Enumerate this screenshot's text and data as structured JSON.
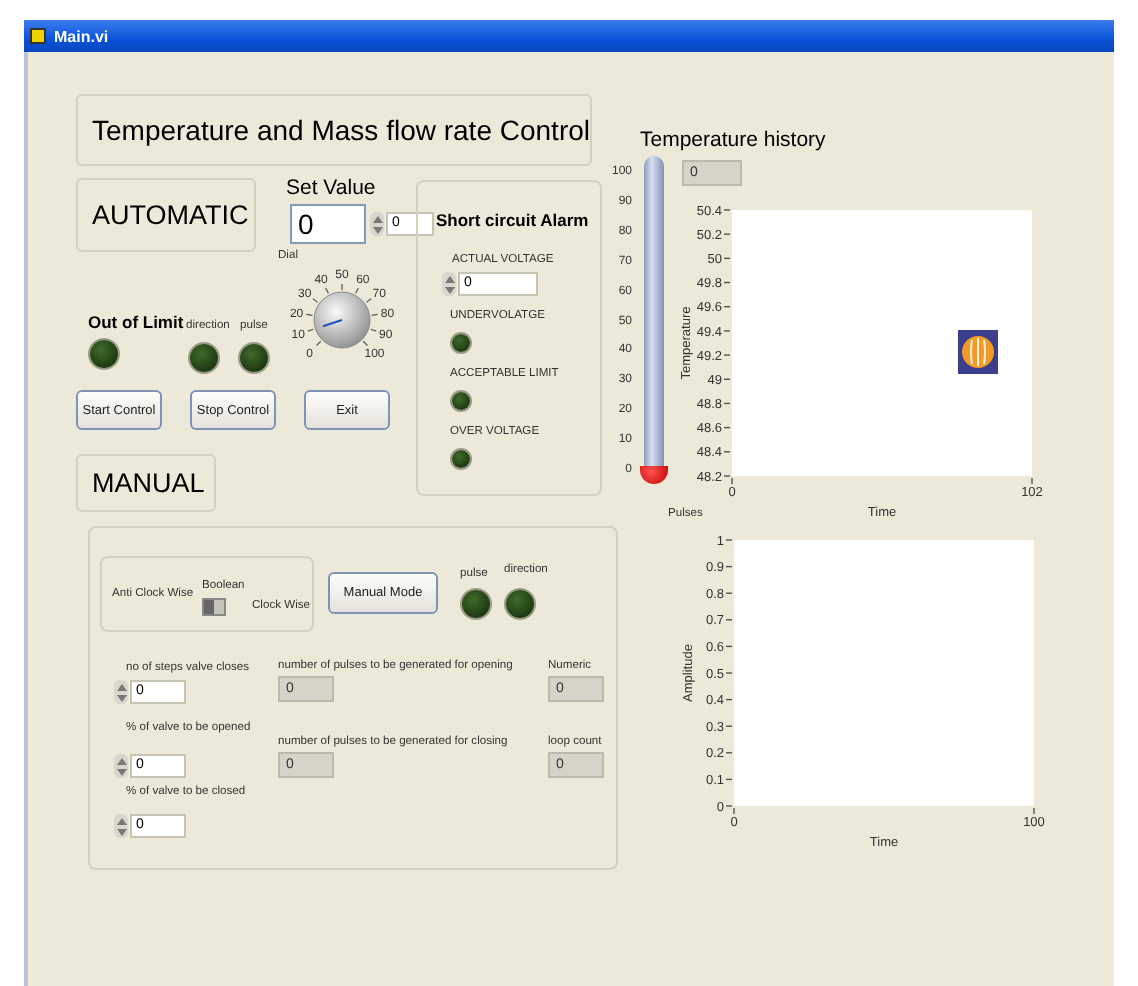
{
  "window": {
    "title": "Main.vi"
  },
  "heading": "Temperature and Mass flow rate Control",
  "automatic": {
    "label": "AUTOMATIC",
    "out_of_limit": {
      "label": "Out of Limit",
      "on": false
    },
    "leds": [
      {
        "label": "direction",
        "on": false
      },
      {
        "label": "pulse",
        "on": false
      }
    ],
    "set_value": {
      "label": "Set Value",
      "value": "0",
      "spinner_value": "0"
    },
    "dial": {
      "label": "Dial",
      "ticks": [
        "0",
        "10",
        "20",
        "30",
        "40",
        "50",
        "60",
        "70",
        "80",
        "90",
        "100"
      ]
    },
    "buttons": [
      "Start Control",
      "Stop Control",
      "Exit"
    ]
  },
  "alarm": {
    "title": "Short circuit  Alarm",
    "actual_voltage": {
      "label": "ACTUAL VOLTAGE",
      "value": "0"
    },
    "indicators": [
      {
        "label": "UNDERVOLATGE",
        "on": false
      },
      {
        "label": "ACCEPTABLE LIMIT",
        "on": false
      },
      {
        "label": "OVER VOLTAGE",
        "on": false
      }
    ]
  },
  "manual": {
    "label": "MANUAL",
    "switch": {
      "left_label": "Anti Clock Wise",
      "label": "Boolean",
      "right_label": "Clock Wise",
      "on": false
    },
    "mode_button": "Manual Mode",
    "leds": [
      {
        "label": "pulse",
        "on": false
      },
      {
        "label": "direction",
        "on": false
      }
    ],
    "inputs": [
      {
        "label": "no of steps valve closes",
        "value": "0"
      },
      {
        "label": "% of valve to be opened",
        "value": "0"
      },
      {
        "label": "% of valve to be  closed",
        "value": "0"
      }
    ],
    "outputs": [
      {
        "label": "number of pulses to be generated for opening",
        "value": "0"
      },
      {
        "label": "Numeric",
        "value": "0"
      },
      {
        "label": "number of pulses to be generated for closing",
        "value": "0"
      },
      {
        "label": "loop count",
        "value": "0"
      }
    ]
  },
  "temperature": {
    "label": "Temperature history",
    "reading": "0",
    "thermometer": {
      "level": 0,
      "ticks": [
        "100",
        "90",
        "80",
        "70",
        "60",
        "50",
        "40",
        "30",
        "20",
        "10",
        "0"
      ]
    },
    "chart_data": {
      "type": "line",
      "xlabel": "Time",
      "ylabel": "Temperature",
      "xlim": [
        0,
        102
      ],
      "ylim": [
        48.2,
        50.4
      ],
      "xticks": [
        0,
        102
      ],
      "yticks": [
        48.2,
        48.4,
        48.6,
        48.8,
        49,
        49.2,
        49.4,
        49.6,
        49.8,
        50,
        50.2,
        50.4
      ]
    }
  },
  "pulses": {
    "label": "Pulses",
    "chart_data": {
      "type": "line",
      "xlabel": "Time",
      "ylabel": "Amplitude",
      "xlim": [
        0,
        100
      ],
      "ylim": [
        0,
        1
      ],
      "xticks": [
        0,
        100
      ],
      "yticks": [
        0,
        0.1,
        0.2,
        0.3,
        0.4,
        0.5,
        0.6,
        0.7,
        0.8,
        0.9,
        1
      ]
    }
  }
}
